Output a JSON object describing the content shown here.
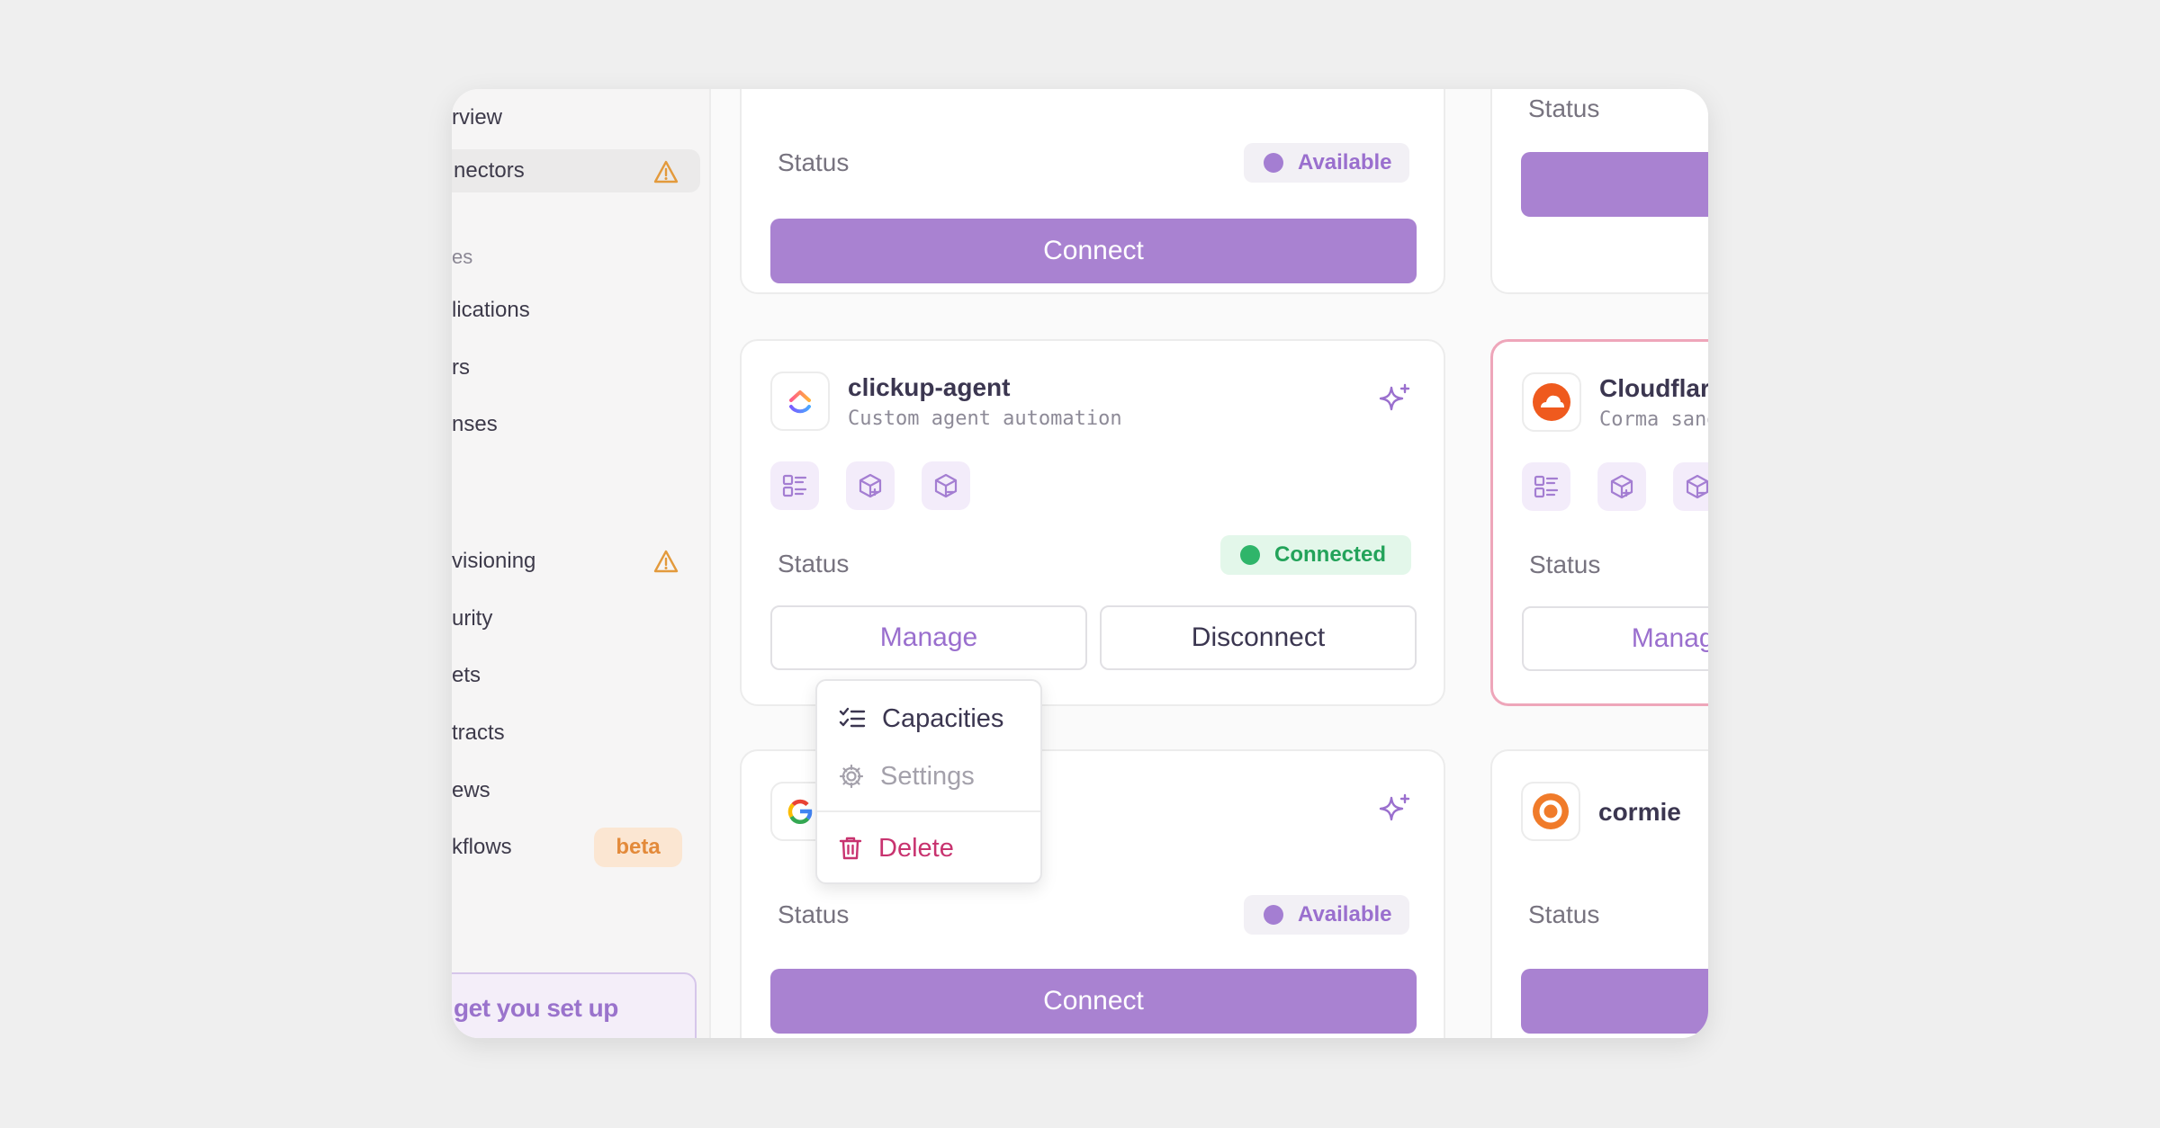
{
  "sidebar": {
    "items": [
      {
        "label": "rview"
      },
      {
        "label": "nectors"
      },
      {
        "label": "lications"
      },
      {
        "label": "rs"
      },
      {
        "label": "nses"
      },
      {
        "label": "visioning"
      },
      {
        "label": "urity"
      },
      {
        "label": "ets"
      },
      {
        "label": "tracts"
      },
      {
        "label": "ews"
      },
      {
        "label": "kflows"
      }
    ],
    "section_label": "es",
    "beta_badge": "beta",
    "setup_label": "get you set up"
  },
  "cards": {
    "top_left": {
      "status_label": "Status",
      "badge": "Available",
      "button": "Connect"
    },
    "top_right": {
      "status_label": "Status"
    },
    "mid_left": {
      "name": "clickup-agent",
      "subtitle": "Custom agent automation",
      "status_label": "Status",
      "badge": "Connected",
      "manage": "Manage",
      "disconnect": "Disconnect"
    },
    "mid_right": {
      "name": "Cloudflare",
      "subtitle": "Corma sandbox",
      "status_label": "Status",
      "manage": "Manage"
    },
    "bottom_left": {
      "status_label": "Status",
      "badge": "Available",
      "button": "Connect"
    },
    "bottom_right": {
      "name": "cormie",
      "status_label": "Status"
    }
  },
  "menu": {
    "capacities": "Capacities",
    "settings": "Settings",
    "delete": "Delete"
  },
  "colors": {
    "accent": "#a982d1",
    "connected": "#2fb56a",
    "danger": "#c8336f",
    "warning": "#e39a3c"
  }
}
